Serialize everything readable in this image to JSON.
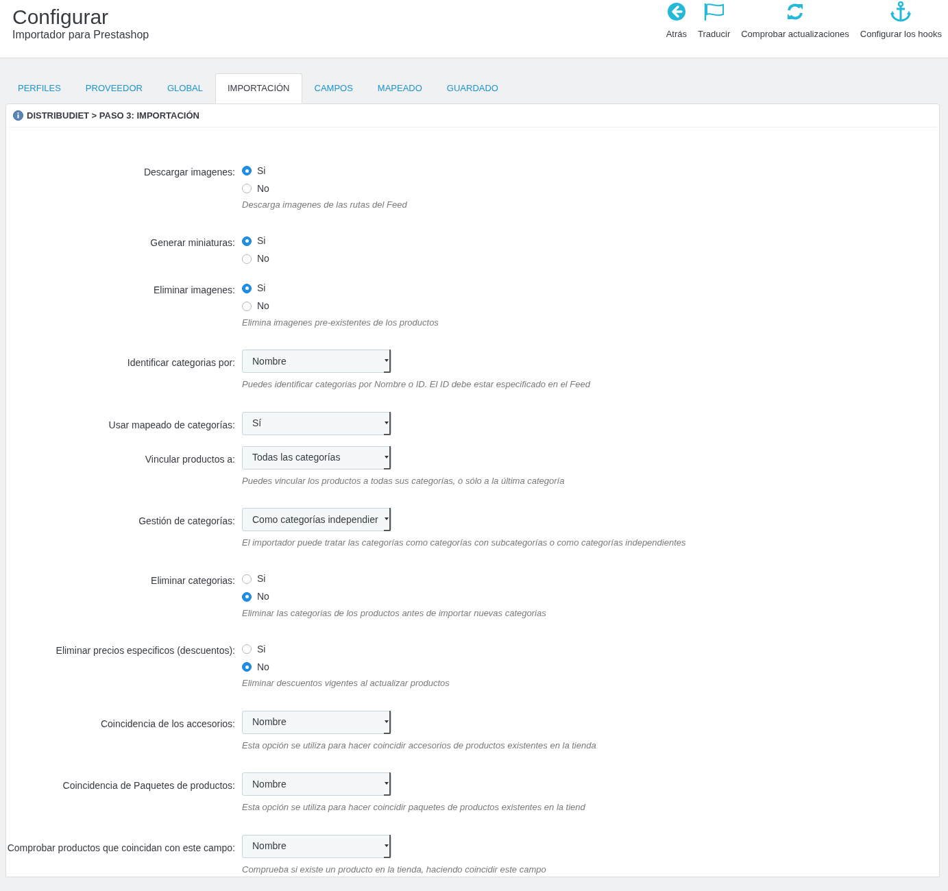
{
  "header": {
    "title": "Configurar",
    "subtitle": "Importador para Prestashop",
    "toolbar": [
      {
        "kind": "back",
        "label": "Atrás"
      },
      {
        "kind": "flag",
        "label": "Traducir"
      },
      {
        "kind": "refresh",
        "label": "Comprobar actualizaciones"
      },
      {
        "kind": "anchor",
        "label": "Configurar los hooks"
      }
    ]
  },
  "tabs": [
    {
      "label": "PERFILES",
      "selected": false
    },
    {
      "label": "PROVEEDOR",
      "selected": false
    },
    {
      "label": "GLOBAL",
      "selected": false
    },
    {
      "label": "IMPORTACIÓN",
      "selected": true
    },
    {
      "label": "CAMPOS",
      "selected": false
    },
    {
      "label": "MAPEADO",
      "selected": false
    },
    {
      "label": "GUARDADO",
      "selected": false
    }
  ],
  "panel": {
    "heading": "DISTRIBUDIET > PASO 3: IMPORTACIÓN",
    "fields": [
      {
        "kind": "radio",
        "label": "Descargar imagenes:",
        "options": [
          {
            "label": "Si",
            "selected": true
          },
          {
            "label": "No",
            "selected": false
          }
        ],
        "help": "Descarga imagenes de las rutas del Feed"
      },
      {
        "kind": "radio",
        "label": "Generar miniaturas:",
        "options": [
          {
            "label": "Si",
            "selected": true
          },
          {
            "label": "No",
            "selected": false
          }
        ]
      },
      {
        "kind": "radio",
        "label": "Eliminar imagenes:",
        "options": [
          {
            "label": "Si",
            "selected": true
          },
          {
            "label": "No",
            "selected": false
          }
        ],
        "help": "Elimina imagenes pre-existentes de los productos"
      },
      {
        "kind": "select",
        "label": "Identificar categorias por:",
        "value": "Nombre",
        "help": "Puedes identificar categorias por Nombre o ID. El ID debe estar especificado en el Feed"
      },
      {
        "kind": "select",
        "label": "Usar mapeado de categorías:",
        "value": "Sí"
      },
      {
        "kind": "select",
        "label": "Vincular productos a:",
        "value": "Todas las categorías",
        "help": "Puedes vincular los productos a todas sus categorías, o sólo a la última categoría"
      },
      {
        "kind": "select",
        "label": "Gestión de categorías:",
        "value": "Como categorías independier",
        "help": "El importador puede tratar las categorías como categorías con subcategorías o como categorías independientes"
      },
      {
        "kind": "radio",
        "label": "Eliminar categorias:",
        "options": [
          {
            "label": "Si",
            "selected": false
          },
          {
            "label": "No",
            "selected": true
          }
        ],
        "help": "Eliminar las categorias de los productos antes de importar nuevas categorias"
      },
      {
        "kind": "radio",
        "label": "Eliminar precios especificos (descuentos):",
        "options": [
          {
            "label": "Si",
            "selected": false
          },
          {
            "label": "No",
            "selected": true
          }
        ],
        "help": "Eliminar descuentos vigentes al actualizar productos"
      },
      {
        "kind": "select",
        "label": "Coincidencia de los accesorios:",
        "value": "Nombre",
        "help": "Esta opción se utiliza para hacer coincidir accesorios de productos existentes en la tienda"
      },
      {
        "kind": "select",
        "label": "Coincidencia de Paquetes de productos:",
        "value": "Nombre",
        "help": "Esta opción se utiliza para hacer coincidir paquetes de productos existentes en la tiend"
      },
      {
        "kind": "select",
        "label": "Comprobar productos que coincidan con este campo:",
        "value": "Nombre",
        "help": "Comprueba si existe un producto en la tienda, haciendo coincidir este campo"
      }
    ]
  }
}
